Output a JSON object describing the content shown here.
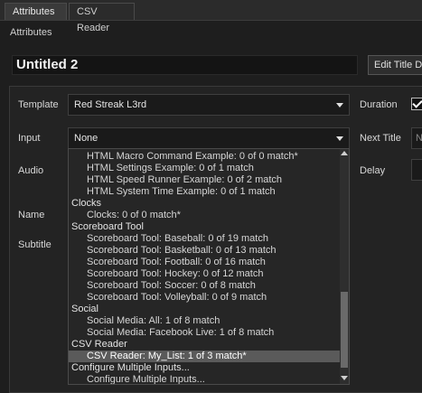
{
  "tabs": [
    {
      "label": "Attributes"
    },
    {
      "label": "CSV Reader"
    }
  ],
  "section_label": "Attributes",
  "title_value": "Untitled 2",
  "edit_title_button": "Edit Title De",
  "fields": {
    "template_label": "Template",
    "template_value": "Red Streak L3rd",
    "duration_label": "Duration",
    "input_label": "Input",
    "input_value": "None",
    "next_title_label": "Next Title",
    "next_title_partial": "N",
    "audio_label": "Audio",
    "delay_label": "Delay",
    "name_label": "Name",
    "subtitle_label": "Subtitle"
  },
  "dropdown_items": [
    {
      "text": "HTML Macro Command Example: 0 of 0 match*",
      "kind": "sub"
    },
    {
      "text": "HTML Settings Example: 0 of 1 match",
      "kind": "sub"
    },
    {
      "text": "HTML Speed Runner Example: 0 of 2 match",
      "kind": "sub"
    },
    {
      "text": "HTML System Time Example: 0 of 1 match",
      "kind": "sub"
    },
    {
      "text": "Clocks",
      "kind": "header"
    },
    {
      "text": "Clocks: 0 of 0 match*",
      "kind": "sub"
    },
    {
      "text": "Scoreboard Tool",
      "kind": "header"
    },
    {
      "text": "Scoreboard Tool: Baseball: 0 of 19 match",
      "kind": "sub"
    },
    {
      "text": "Scoreboard Tool: Basketball: 0 of 13 match",
      "kind": "sub"
    },
    {
      "text": "Scoreboard Tool: Football: 0 of 16 match",
      "kind": "sub"
    },
    {
      "text": "Scoreboard Tool: Hockey: 0 of 12 match",
      "kind": "sub"
    },
    {
      "text": "Scoreboard Tool: Soccer: 0 of 8 match",
      "kind": "sub"
    },
    {
      "text": "Scoreboard Tool: Volleyball: 0 of 9 match",
      "kind": "sub"
    },
    {
      "text": "Social",
      "kind": "header"
    },
    {
      "text": "Social Media: All: 1 of 8 match",
      "kind": "sub"
    },
    {
      "text": "Social Media: Facebook Live: 1 of 8 match",
      "kind": "sub"
    },
    {
      "text": "CSV Reader",
      "kind": "header"
    },
    {
      "text": "CSV Reader: My_List: 1 of 3 match*",
      "kind": "sub",
      "selected": true
    },
    {
      "text": "Configure Multiple Inputs...",
      "kind": "header"
    },
    {
      "text": "Configure Multiple Inputs...",
      "kind": "sub"
    }
  ]
}
